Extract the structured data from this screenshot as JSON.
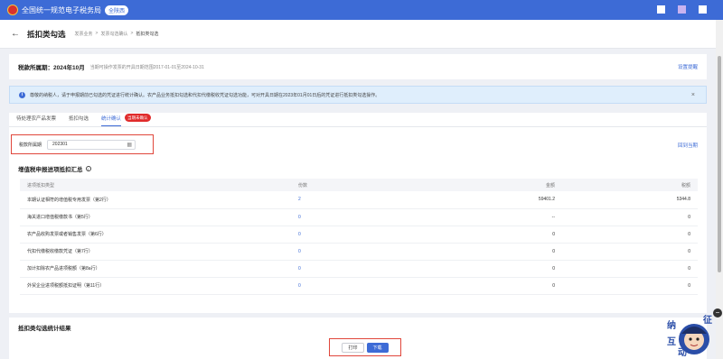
{
  "header": {
    "brand": "全国统一规范电子税务局",
    "region": "全陕西",
    "accent": "#3d6bd6"
  },
  "breadcrumb": {
    "title": "抵扣类勾选",
    "items": [
      "发票业务",
      ">",
      "发票勾选确认",
      ">",
      "抵扣类勾选"
    ]
  },
  "period": {
    "label": "税款所属期：2024年10月",
    "note": "当期可操作发票的开具日期范围2017-01-01至2024-10-31",
    "settings_link": "设置提醒"
  },
  "notice": {
    "text": "尊敬的纳税人，请于申报期前已勾选的凭证进行统计确认。农产品业务抵扣勾选和代扣代缴税收凭证勾选功能，可对开具日期在2023年01月01日后的凭证进行抵扣类勾选操作。"
  },
  "tabs": [
    {
      "label": "待处理农产品发票",
      "active": false
    },
    {
      "label": "抵扣勾选",
      "active": false
    },
    {
      "label": "统计确认",
      "active": true,
      "badge": "当期未确认"
    }
  ],
  "filter": {
    "label": "税款所属期",
    "value": "202301",
    "back_current": "回到当期"
  },
  "summary": {
    "title": "增值税申报进项抵扣汇总",
    "columns": [
      "进项抵扣类型",
      "份数",
      "金额",
      "税额"
    ],
    "rows": [
      [
        "本期认证相符的增值税专用发票（第2行）",
        "2",
        "59401.2",
        "5344.8"
      ],
      [
        "海关进口增值税缴款书（第5行）",
        "0",
        "--",
        "0"
      ],
      [
        "农产品收购发票或者销售发票（第6行）",
        "0",
        "0",
        "0"
      ],
      [
        "代扣代缴税收缴款凭证（第7行）",
        "0",
        "0",
        "0"
      ],
      [
        "加计扣除农产品进项税额（第8a行）",
        "0",
        "0",
        "0"
      ],
      [
        "外贸企业进项税额抵扣证明（第11行）",
        "0",
        "0",
        "0"
      ]
    ]
  },
  "stats": {
    "title": "抵扣类勾选统计结果"
  },
  "actions": {
    "print": "打印",
    "download": "下载"
  },
  "mascot": {
    "text": "纳 征 互 动"
  }
}
